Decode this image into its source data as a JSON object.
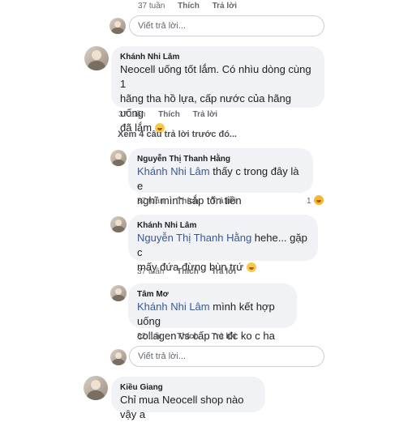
{
  "top_meta": {
    "time": "37 tuần",
    "like": "Thích",
    "reply": "Trả lời"
  },
  "reply_input_1": {
    "placeholder": "Viết trả lời..."
  },
  "comment_main": {
    "author": "Khánh Nhi Lâm",
    "text": "Neocell uống tốt lắm. Có nhìu dòng cùng 1 hãng tha hồ lựa, cấp nước của hãng uống đã lắm",
    "line1": "Neocell uống tốt lắm. Có nhìu dòng cùng 1",
    "line2": "hãng tha hồ lựa, cấp nước của hãng uống",
    "line3": "đã lắm",
    "time": "37 tuần",
    "like": "Thích",
    "reply": "Trả lời"
  },
  "view_previous": "Xem 4 câu trả lời trước đó...",
  "replies": [
    {
      "author": "Nguyễn Thị Thanh Hằng",
      "mention": "Khánh Nhi Lâm",
      "text_line1": " thấy c trong đây là e",
      "text_line2": "nghĩ mình sắp tốn tiền",
      "time": "37 tuần",
      "like": "Thích",
      "reply": "Trả lời",
      "reaction_count": "1"
    },
    {
      "author": "Khánh Nhi Lâm",
      "mention": "Nguyễn Thị Thanh Hằng",
      "text_line1": " hehe... gặp c",
      "text_line2": "mấy đứa đừng bùn trứ",
      "time": "37 tuần",
      "like": "Thích",
      "reply": "Trả lời"
    },
    {
      "author": "Tâm Mơ",
      "mention": "Khánh Nhi Lâm",
      "text_line1": " mình kết hợp uống",
      "text_line2": "collagen vs cấp nc đc ko c ha",
      "time": "32 tuần",
      "like": "Thích",
      "reply": "Trả lời"
    }
  ],
  "reply_input_2": {
    "placeholder": "Viết trả lời..."
  },
  "comment_bottom": {
    "author": "Kiều Giang",
    "text": "Chỉ mua Neocell shop nào vậy a"
  }
}
